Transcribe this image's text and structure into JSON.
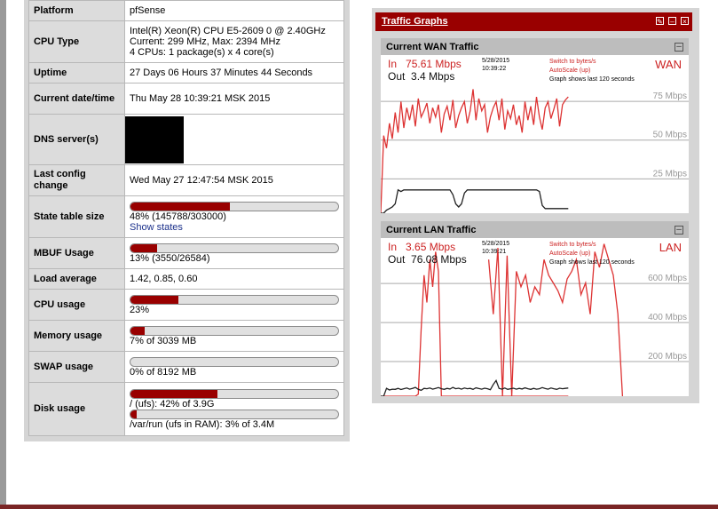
{
  "system_info": {
    "rows": [
      {
        "label": "Platform",
        "lines": [
          "pfSense"
        ]
      },
      {
        "label": "CPU Type",
        "lines": [
          "Intel(R) Xeon(R) CPU E5-2609 0 @ 2.40GHz",
          "Current: 299 MHz, Max: 2394 MHz",
          "4 CPUs: 1 package(s) x 4 core(s)"
        ]
      },
      {
        "label": "Uptime",
        "lines": [
          "27 Days 06 Hours 37 Minutes 44 Seconds"
        ]
      },
      {
        "label": "Current date/time",
        "lines": [
          "Thu May 28 10:39:21 MSK 2015"
        ]
      },
      {
        "label": "DNS server(s)",
        "lines": []
      },
      {
        "label": "Last config change",
        "lines": [
          "Wed May 27 12:47:54 MSK 2015"
        ]
      },
      {
        "label": "State table size",
        "percent": 48,
        "text": "48% (145788/303000)",
        "link": "Show states"
      },
      {
        "label": "MBUF Usage",
        "percent": 13,
        "text": "13% (3550/26584)"
      },
      {
        "label": "Load average",
        "lines": [
          "1.42, 0.85, 0.60"
        ]
      },
      {
        "label": "CPU usage",
        "percent": 23,
        "text": "23%"
      },
      {
        "label": "Memory usage",
        "percent": 7,
        "text": "7% of 3039 MB"
      },
      {
        "label": "SWAP usage",
        "percent": 0,
        "text": "0% of 8192 MB"
      },
      {
        "label": "Disk usage",
        "disks": [
          {
            "percent": 42,
            "text": "/ (ufs): 42% of 3.9G"
          },
          {
            "percent": 3,
            "text": "/var/run (ufs in RAM): 3% of 3.4M"
          }
        ]
      }
    ]
  },
  "traffic_graphs": {
    "title": "Traffic Graphs",
    "accent_color": "#990000",
    "graphs": [
      {
        "title": "Current WAN Traffic",
        "interface": "WAN",
        "in_label": "In",
        "in_value": "75.61 Mbps",
        "out_label": "Out",
        "out_value": "3.4 Mbps",
        "date": "5/28/2015",
        "time": "10:39:22",
        "switch_label": "Switch to bytes/s",
        "autoscale_label": "AutoScale (up)",
        "window_label": "Graph shows last 120 seconds",
        "ticks": [
          "75 Mbps",
          "50 Mbps",
          "25 Mbps"
        ],
        "tick_values": [
          75,
          50,
          25
        ],
        "ymax": 102,
        "in_series": [
          0,
          50,
          42,
          58,
          48,
          65,
          52,
          72,
          55,
          68,
          60,
          70,
          56,
          74,
          62,
          66,
          71,
          58,
          68,
          62,
          70,
          52,
          64,
          69,
          60,
          73,
          55,
          63,
          68,
          72,
          58,
          66,
          80,
          60,
          74,
          66,
          70,
          52,
          62,
          68,
          72,
          60,
          74,
          54,
          66,
          61,
          70,
          57,
          63,
          52,
          72,
          60,
          69,
          57,
          75,
          62,
          54,
          68,
          72,
          61,
          67,
          74,
          56,
          70,
          73,
          75
        ],
        "out_series": [
          0,
          0,
          2,
          3,
          4,
          6,
          15,
          14,
          15,
          15,
          15,
          15,
          15,
          15,
          15,
          15,
          15,
          15,
          15,
          15,
          15,
          15,
          15,
          15,
          15,
          12,
          6,
          4,
          6,
          13,
          15,
          15,
          15,
          15,
          15,
          15,
          15,
          15,
          15,
          15,
          15,
          15,
          15,
          15,
          15,
          15,
          15,
          15,
          15,
          15,
          15,
          15,
          15,
          15,
          15,
          14,
          5,
          3,
          3,
          3,
          3,
          3,
          3,
          3,
          3,
          3
        ]
      },
      {
        "title": "Current LAN Traffic",
        "interface": "LAN",
        "in_label": "In",
        "in_value": "3.65 Mbps",
        "out_label": "Out",
        "out_value": "76.08 Mbps",
        "date": "5/28/2015",
        "time": "10:39:21",
        "switch_label": "Switch to bytes/s",
        "autoscale_label": "AutoScale (up)",
        "window_label": "Graph shows last 120 seconds",
        "ticks": [
          "600 Mbps",
          "400 Mbps",
          "200 Mbps"
        ],
        "tick_values": [
          600,
          400,
          200
        ],
        "ymax": 810,
        "in_series": [
          0,
          0,
          0,
          0,
          0,
          0,
          0,
          0,
          0,
          0,
          0,
          0,
          0,
          10,
          340,
          620,
          480,
          700,
          560,
          740,
          640,
          0,
          0,
          0,
          0,
          0,
          0,
          0,
          0,
          0,
          0,
          0,
          0,
          0,
          0,
          0,
          0,
          0,
          0,
          0,
          0,
          0,
          0,
          0,
          0,
          0,
          0,
          0,
          0,
          0,
          0,
          0,
          0,
          0,
          0,
          0,
          0,
          0,
          0,
          0,
          0,
          0,
          0,
          0,
          0,
          0
        ],
        "out_series": [
          0,
          0,
          40,
          32,
          36,
          35,
          40,
          34,
          38,
          42,
          36,
          40,
          45,
          35,
          30,
          40,
          38,
          42,
          36,
          40,
          44,
          38,
          35,
          40,
          37,
          45,
          38,
          41,
          36,
          42,
          38,
          40,
          35,
          43,
          39,
          36,
          41,
          38,
          33,
          60,
          80,
          40,
          36,
          42,
          35,
          38,
          41,
          36,
          40,
          37,
          43,
          38,
          35,
          40,
          36,
          38,
          44,
          39,
          36,
          42,
          38,
          35,
          41,
          38,
          40,
          42
        ],
        "spikes": [
          {
            "at": 33,
            "values": [
              700,
              420,
              760,
              0,
              720,
              0,
              640,
              560,
              620,
              480,
              560,
              520,
              700,
              620,
              580,
              540,
              480,
              600,
              640,
              700,
              520,
              580,
              420,
              740,
              660,
              780,
              700,
              620,
              420,
              0
            ]
          }
        ]
      }
    ]
  }
}
